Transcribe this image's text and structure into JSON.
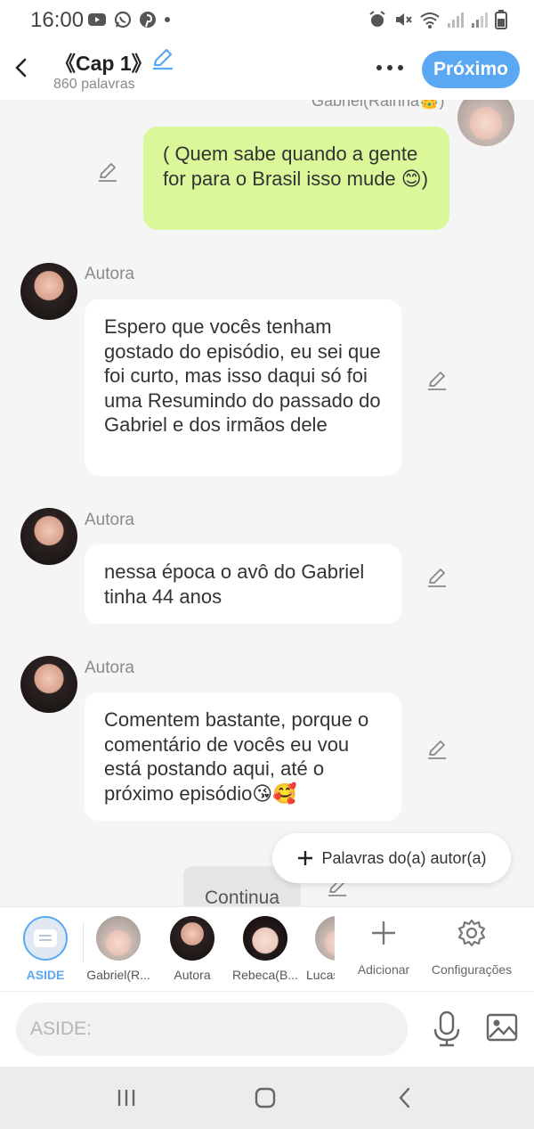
{
  "status_bar": {
    "time": "16:00"
  },
  "header": {
    "chapter_title": "《Cap 1》",
    "word_count": "860 palavras",
    "next_label": "Próximo"
  },
  "chat": {
    "partial_sender": "Gabriel(Rainha👑)",
    "messages": [
      {
        "sender": "",
        "text": "( Quem sabe quando a gente for para o Brasil isso mude 😊)"
      },
      {
        "sender": "Autora",
        "text": "Espero que vocês tenham gostado do episódio, eu sei que foi curto, mas isso daqui só foi uma Resumindo do passado do Gabriel e dos irmãos dele"
      },
      {
        "sender": "Autora",
        "text": "nessa época o avô do Gabriel tinha 44 anos"
      },
      {
        "sender": "Autora",
        "text": "Comentem bastante, porque o comentário de vocês eu vou está postando aqui, até o próximo episódio😘🥰"
      }
    ],
    "author_words_label": "Palavras do(a) autor(a)",
    "continue_label": "Continua"
  },
  "characters": [
    {
      "label": "ASIDE",
      "avatar": "aside-icon"
    },
    {
      "label": "Gabriel(R...",
      "avatar": "male-avatar"
    },
    {
      "label": "Autora",
      "avatar": "female-avatar"
    },
    {
      "label": "Rebeca(B...",
      "avatar": "girl-avatar"
    },
    {
      "label": "Lucas",
      "avatar": "male-avatar"
    }
  ],
  "tools": {
    "add_label": "Adicionar",
    "settings_label": "Configurações"
  },
  "input": {
    "placeholder": "ASIDE:"
  },
  "colors": {
    "accent": "#5aa8f4",
    "bubble_green": "#daf79a",
    "background": "#f5f5f5"
  }
}
